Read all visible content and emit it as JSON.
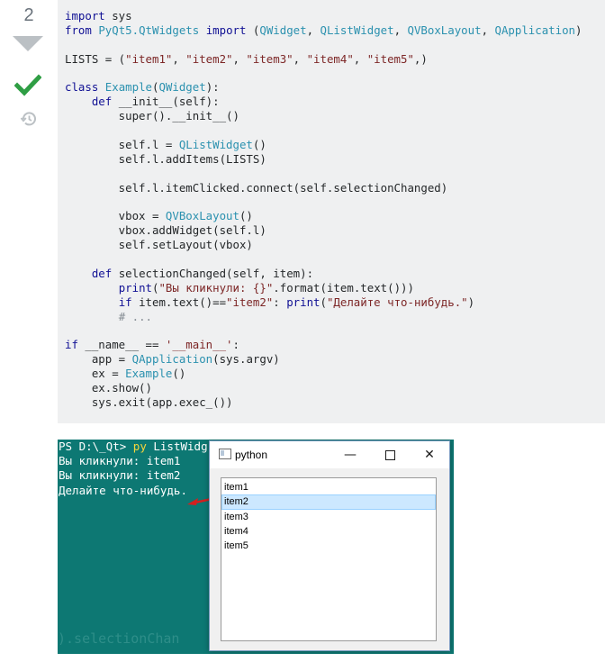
{
  "vote": {
    "count": "2",
    "downvote_icon": "triangle-down-icon",
    "accepted_icon": "checkmark-icon",
    "history_icon": "history-icon",
    "accent_green": "#2f9e44"
  },
  "code": {
    "lines": [
      [
        {
          "t": "kw",
          "v": "import"
        },
        {
          "t": "",
          "v": " sys"
        }
      ],
      [
        {
          "t": "kw",
          "v": "from"
        },
        {
          "t": "",
          "v": " "
        },
        {
          "t": "fn",
          "v": "PyQt5.QtWidgets"
        },
        {
          "t": "",
          "v": " "
        },
        {
          "t": "kw",
          "v": "import"
        },
        {
          "t": "",
          "v": " ("
        },
        {
          "t": "fn",
          "v": "QWidget"
        },
        {
          "t": "",
          "v": ", "
        },
        {
          "t": "fn",
          "v": "QListWidget"
        },
        {
          "t": "",
          "v": ", "
        },
        {
          "t": "fn",
          "v": "QVBoxLayout"
        },
        {
          "t": "",
          "v": ", "
        },
        {
          "t": "fn",
          "v": "QApplication"
        },
        {
          "t": "",
          "v": ")"
        }
      ],
      [],
      [
        {
          "t": "",
          "v": "LISTS = ("
        },
        {
          "t": "str",
          "v": "\"item1\""
        },
        {
          "t": "",
          "v": ", "
        },
        {
          "t": "str",
          "v": "\"item2\""
        },
        {
          "t": "",
          "v": ", "
        },
        {
          "t": "str",
          "v": "\"item3\""
        },
        {
          "t": "",
          "v": ", "
        },
        {
          "t": "str",
          "v": "\"item4\""
        },
        {
          "t": "",
          "v": ", "
        },
        {
          "t": "str",
          "v": "\"item5\""
        },
        {
          "t": "",
          "v": ",)"
        }
      ],
      [],
      [
        {
          "t": "kw",
          "v": "class"
        },
        {
          "t": "",
          "v": " "
        },
        {
          "t": "fn",
          "v": "Example"
        },
        {
          "t": "",
          "v": "("
        },
        {
          "t": "fn",
          "v": "QWidget"
        },
        {
          "t": "",
          "v": "):"
        }
      ],
      [
        {
          "t": "",
          "v": "    "
        },
        {
          "t": "kw",
          "v": "def"
        },
        {
          "t": "",
          "v": " __init__(self):"
        }
      ],
      [
        {
          "t": "",
          "v": "        super().__init__()"
        }
      ],
      [],
      [
        {
          "t": "",
          "v": "        self.l = "
        },
        {
          "t": "fn",
          "v": "QListWidget"
        },
        {
          "t": "",
          "v": "()"
        }
      ],
      [
        {
          "t": "",
          "v": "        self.l.addItems(LISTS)"
        }
      ],
      [],
      [
        {
          "t": "",
          "v": "        self.l.itemClicked.connect(self.selectionChanged)"
        }
      ],
      [],
      [
        {
          "t": "",
          "v": "        vbox = "
        },
        {
          "t": "fn",
          "v": "QVBoxLayout"
        },
        {
          "t": "",
          "v": "()"
        }
      ],
      [
        {
          "t": "",
          "v": "        vbox.addWidget(self.l)"
        }
      ],
      [
        {
          "t": "",
          "v": "        self.setLayout(vbox)"
        }
      ],
      [],
      [
        {
          "t": "",
          "v": "    "
        },
        {
          "t": "kw",
          "v": "def"
        },
        {
          "t": "",
          "v": " selectionChanged(self, item):"
        }
      ],
      [
        {
          "t": "",
          "v": "        "
        },
        {
          "t": "kw",
          "v": "print"
        },
        {
          "t": "",
          "v": "("
        },
        {
          "t": "str",
          "v": "\"Вы кликнули: {}\""
        },
        {
          "t": "",
          "v": ".format(item.text()))"
        }
      ],
      [
        {
          "t": "",
          "v": "        "
        },
        {
          "t": "kw",
          "v": "if"
        },
        {
          "t": "",
          "v": " item.text()=="
        },
        {
          "t": "str",
          "v": "\"item2\""
        },
        {
          "t": "",
          "v": ": "
        },
        {
          "t": "kw",
          "v": "print"
        },
        {
          "t": "",
          "v": "("
        },
        {
          "t": "str",
          "v": "\"Делайте что-нибудь.\""
        },
        {
          "t": "",
          "v": ")"
        }
      ],
      [
        {
          "t": "",
          "v": "        "
        },
        {
          "t": "cmt",
          "v": "# ..."
        }
      ],
      [],
      [
        {
          "t": "kw",
          "v": "if"
        },
        {
          "t": "",
          "v": " __name__ == "
        },
        {
          "t": "str",
          "v": "'__main__'"
        },
        {
          "t": "",
          "v": ":"
        }
      ],
      [
        {
          "t": "",
          "v": "    app = "
        },
        {
          "t": "fn",
          "v": "QApplication"
        },
        {
          "t": "",
          "v": "(sys.argv)"
        }
      ],
      [
        {
          "t": "",
          "v": "    ex = "
        },
        {
          "t": "fn",
          "v": "Example"
        },
        {
          "t": "",
          "v": "()"
        }
      ],
      [
        {
          "t": "",
          "v": "    ex.show()"
        }
      ],
      [
        {
          "t": "",
          "v": "    sys.exit(app.exec_())"
        }
      ]
    ]
  },
  "terminal": {
    "prompt": "PS D:\\_Qt> ",
    "command": "py",
    "command_rest": " ListWidg",
    "output": [
      "Вы кликнули: item1",
      "Вы кликнули: item2",
      "Делайте что-нибудь."
    ],
    "ghost": ").selectionChan"
  },
  "qt_window": {
    "title": "python",
    "minimize_label": "—",
    "close_label": "✕",
    "items": [
      "item1",
      "item2",
      "item3",
      "item4",
      "item5"
    ],
    "selected": "item2"
  },
  "arrow_color": "#d32020"
}
